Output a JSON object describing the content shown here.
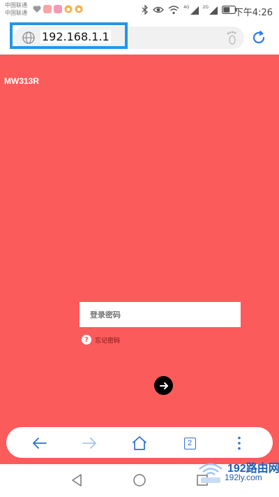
{
  "status_bar": {
    "carrier_1": "中国联通",
    "carrier_2": "中国联通",
    "network_1": "4G",
    "network_2": "2G",
    "time": "下午4:26"
  },
  "address_bar": {
    "url": "192.168.1.1"
  },
  "page": {
    "model_name": "MW313R",
    "password_placeholder": "登录密码",
    "forgot_password": "忘记密码",
    "background_color": "#fb5b5b"
  },
  "toolbar": {
    "tab_count": "2"
  },
  "watermark": {
    "title": "192路由网",
    "subtitle": "192ly.com"
  },
  "colors": {
    "accent_blue": "#2196e8",
    "toolbar_icon_blue": "#2b6fd6",
    "watermark_blue": "#1c5fb8"
  }
}
